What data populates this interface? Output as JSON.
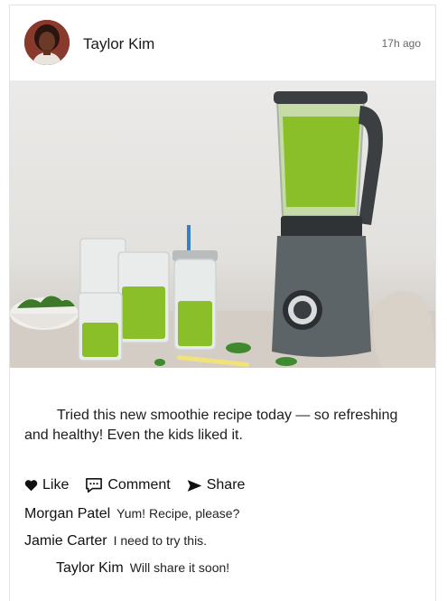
{
  "post": {
    "author": "Taylor Kim",
    "timestamp": "17h ago",
    "text": "Tried this new smoothie recipe today — so refreshing and healthy! Even the kids liked it.",
    "image_subject": "blender-with-green-smoothie-glasses"
  },
  "actions": {
    "like_label": "Like",
    "comment_label": "Comment",
    "share_label": "Share"
  },
  "comments": [
    {
      "author": "Morgan Patel",
      "text": "Yum! Recipe, please?"
    },
    {
      "author": "Jamie Carter",
      "text": "I need to try this."
    },
    {
      "author": "Taylor Kim",
      "text": "Will share it soon!"
    }
  ],
  "icons": {
    "like": "heart-icon",
    "comment": "speech-bubble-icon",
    "share": "send-arrow-icon"
  },
  "colors": {
    "smoothie_green": "#8bbf2a",
    "blender_body": "#5d6468",
    "text": "#111111",
    "muted": "#666666"
  }
}
